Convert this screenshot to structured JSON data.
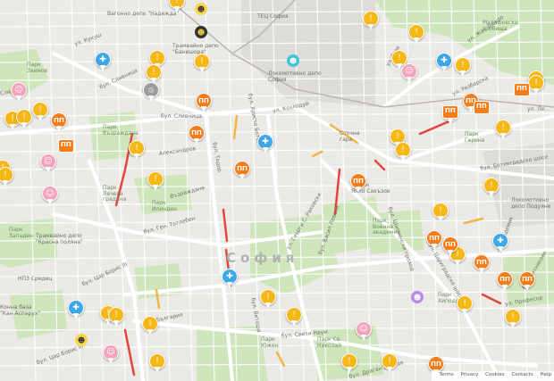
{
  "map": {
    "city_label": "София",
    "streets": [
      {
        "id": "kukush",
        "text": "ул. Кукуш"
      },
      {
        "id": "slivnitsa",
        "text": "бул. Сливница"
      },
      {
        "id": "slivnitsa2",
        "text": "бул. Сливница"
      },
      {
        "id": "slivnitsa3",
        "text": "Сливница"
      },
      {
        "id": "kozloduy",
        "text": "ул. Козлодуй"
      },
      {
        "id": "aleksandrov",
        "text": "Александров"
      },
      {
        "id": "hristo_botev",
        "text": "бул. Христо Ботев"
      },
      {
        "id": "todor",
        "text": "бул. Тодор"
      },
      {
        "id": "vazrazhdane",
        "text": "Възраждане"
      },
      {
        "id": "gen_totleben",
        "text": "бул. Ген. Тотлебен"
      },
      {
        "id": "tsar_boris",
        "text": "бул. Цар Борис III"
      },
      {
        "id": "tsar_boris2",
        "text": "бул. Цар Борис III"
      },
      {
        "id": "balgariya",
        "text": "бул. България"
      },
      {
        "id": "vitosha",
        "text": "бул. Витоша"
      },
      {
        "id": "sveti_naum",
        "text": "бул. Свети Наум"
      },
      {
        "id": "vasil_levski",
        "text": "бул. Васил Левски"
      },
      {
        "id": "georgi",
        "text": "ул. Георги С. Раковски"
      },
      {
        "id": "shipchenski",
        "text": "бул. Шипченски проход"
      },
      {
        "id": "tsarigradsko",
        "text": "бул. Цариградско шосе"
      },
      {
        "id": "dragan",
        "text": "бул. Драган Цанков"
      },
      {
        "id": "botevgradsko",
        "text": "бул. Ботевградско шосе"
      },
      {
        "id": "rezbarska",
        "text": "ул. Резбарска"
      },
      {
        "id": "zhak_dekroa",
        "text": "ул. Жак Дюкро"
      },
      {
        "id": "roj",
        "text": "ул. Розе"
      },
      {
        "id": "levski",
        "text": "ул. Ле..."
      },
      {
        "id": "sitnyakovo",
        "text": "бул. Ситняково"
      },
      {
        "id": "akademik",
        "text": "ул. Академик"
      },
      {
        "id": "sakazov",
        "text": "Янко Сакъзов"
      },
      {
        "id": "mladost",
        "text": "ул. Професор"
      }
    ],
    "places": [
      {
        "id": "tramdepo_nadezhda",
        "text": "Вагонно депо \"Надежда\""
      },
      {
        "id": "tramdepo_banishora",
        "text": "Трамвайно депо \"Банишора\""
      },
      {
        "id": "tets",
        "text": "ТЕЦ София"
      },
      {
        "id": "lokodepo",
        "text": "Локомотивно депо София"
      },
      {
        "id": "malashevski",
        "text": "Малашевски гробища"
      },
      {
        "id": "sortirovachna",
        "text": "Сточна гара"
      },
      {
        "id": "tramdepo_krasna",
        "text": "Трамвайно депо \"Красна поляна\""
      },
      {
        "id": "nrz",
        "text": "НПЗ Средец"
      },
      {
        "id": "lokodepo_poduyane",
        "text": "Локомотивно депо Подуяне"
      },
      {
        "id": "park_zaimov",
        "text": "Парк Заимов"
      },
      {
        "id": "park_vazrazhdane",
        "text": "Парк Възраждане"
      },
      {
        "id": "park_lecheva",
        "text": "Парк Лечева градина"
      },
      {
        "id": "park_borisova",
        "text": "Парк Военна академия"
      },
      {
        "id": "park_zapaden",
        "text": "Парк Западен"
      },
      {
        "id": "park_ilinden",
        "text": "Парк Илинден"
      },
      {
        "id": "park_gerena",
        "text": "Парк Герена"
      },
      {
        "id": "park_hippodrom",
        "text": "Парк Хиподрума"
      },
      {
        "id": "konna_baza",
        "text": "Конна база \"Кан Аспарух\""
      },
      {
        "id": "park_yuzhen",
        "text": "Парк Южен"
      },
      {
        "id": "park_sv_nikolay",
        "text": "Парк Св. Николай"
      },
      {
        "id": "park_pri",
        "text": "Парк"
      }
    ],
    "colors": {
      "jam_orange": "#f77d1a",
      "hazard_yellow": "#f6b817",
      "police_blue": "#3ea7e8",
      "traffic_red": "#e3463e",
      "traffic_yellow": "#f2b544",
      "park_green": "#c9e3b2"
    },
    "pins": [
      {
        "type": "hazard",
        "icon": "hazard-icon"
      },
      {
        "type": "police",
        "icon": "police-icon"
      },
      {
        "type": "jam",
        "icon": "traffic-jam-icon"
      },
      {
        "type": "closure",
        "icon": "closure-icon"
      },
      {
        "type": "user",
        "icon": "user-report-icon"
      }
    ]
  },
  "footer": {
    "links": [
      "Terms",
      "Privacy",
      "Cookies",
      "Contacts",
      "Help"
    ]
  }
}
